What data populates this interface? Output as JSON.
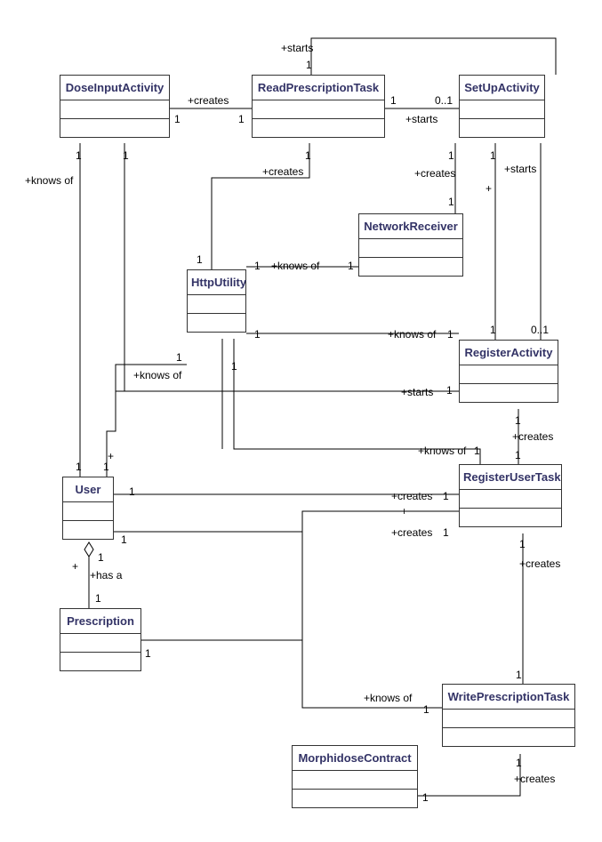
{
  "classes": {
    "doseInputActivity": "DoseInputActivity",
    "readPrescriptionTask": "ReadPrescriptionTask",
    "setUpActivity": "SetUpActivity",
    "networkReceiver": "NetworkReceiver",
    "httpUtility": "HttpUtility",
    "registerActivity": "RegisterActivity",
    "user": "User",
    "registerUserTask": "RegisterUserTask",
    "prescription": "Prescription",
    "writePrescriptionTask": "WritePrescriptionTask",
    "morphidoseContract": "MorphidoseContract"
  },
  "labels": {
    "starts": "+starts",
    "creates": "+creates",
    "knowsOf": "+knows of",
    "hasA": "+has a",
    "one": "1",
    "zeroOne": "0..1",
    "plus": "+"
  }
}
